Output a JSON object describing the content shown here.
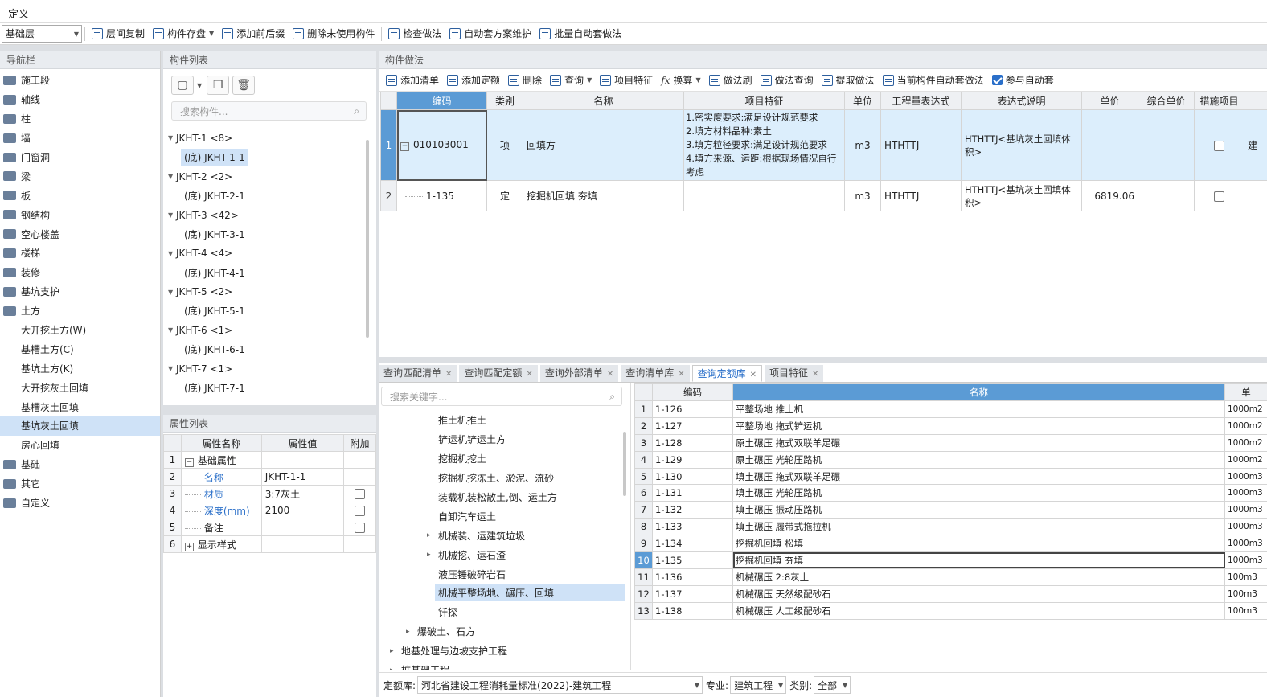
{
  "title": "定义",
  "toolbar": {
    "floor_select": "基础层",
    "buttons": [
      "层间复制",
      "构件存盘",
      "添加前后缀",
      "删除未使用构件",
      "检查做法",
      "自动套方案维护",
      "批量自动套做法"
    ]
  },
  "nav": {
    "header": "导航栏",
    "items": [
      {
        "label": "施工段",
        "sub": false
      },
      {
        "label": "轴线",
        "sub": false
      },
      {
        "label": "柱",
        "sub": false
      },
      {
        "label": "墙",
        "sub": false
      },
      {
        "label": "门窗洞",
        "sub": false
      },
      {
        "label": "梁",
        "sub": false
      },
      {
        "label": "板",
        "sub": false
      },
      {
        "label": "钢结构",
        "sub": false
      },
      {
        "label": "空心楼盖",
        "sub": false
      },
      {
        "label": "楼梯",
        "sub": false
      },
      {
        "label": "装修",
        "sub": false
      },
      {
        "label": "基坑支护",
        "sub": false
      },
      {
        "label": "土方",
        "sub": false
      },
      {
        "label": "大开挖土方(W)",
        "sub": true
      },
      {
        "label": "基槽土方(C)",
        "sub": true
      },
      {
        "label": "基坑土方(K)",
        "sub": true
      },
      {
        "label": "大开挖灰土回填",
        "sub": true
      },
      {
        "label": "基槽灰土回填",
        "sub": true
      },
      {
        "label": "基坑灰土回填",
        "sub": true,
        "selected": true
      },
      {
        "label": "房心回填",
        "sub": true
      },
      {
        "label": "基础",
        "sub": false
      },
      {
        "label": "其它",
        "sub": false
      },
      {
        "label": "自定义",
        "sub": false
      }
    ]
  },
  "components": {
    "header": "构件列表",
    "search_placeholder": "搜索构件...",
    "tree": [
      {
        "label": "JKHT-1 <8>",
        "group": true
      },
      {
        "label": "(底) JKHT-1-1",
        "group": false,
        "selected": true
      },
      {
        "label": "JKHT-2 <2>",
        "group": true
      },
      {
        "label": "(底) JKHT-2-1",
        "group": false
      },
      {
        "label": "JKHT-3 <42>",
        "group": true
      },
      {
        "label": "(底) JKHT-3-1",
        "group": false
      },
      {
        "label": "JKHT-4 <4>",
        "group": true
      },
      {
        "label": "(底) JKHT-4-1",
        "group": false
      },
      {
        "label": "JKHT-5 <2>",
        "group": true
      },
      {
        "label": "(底) JKHT-5-1",
        "group": false
      },
      {
        "label": "JKHT-6 <1>",
        "group": true
      },
      {
        "label": "(底) JKHT-6-1",
        "group": false
      },
      {
        "label": "JKHT-7 <1>",
        "group": true
      },
      {
        "label": "(底) JKHT-7-1",
        "group": false
      }
    ]
  },
  "properties": {
    "header": "属性列表",
    "columns": [
      "属性名称",
      "属性值",
      "附加"
    ],
    "rows": [
      {
        "n": "1",
        "name": "基础属性",
        "value": "",
        "expand": "−",
        "blue": false,
        "check": false
      },
      {
        "n": "2",
        "name": "名称",
        "value": "JKHT-1-1",
        "blue": true,
        "check": false
      },
      {
        "n": "3",
        "name": "材质",
        "value": "3:7灰土",
        "blue": true,
        "check": true
      },
      {
        "n": "4",
        "name": "深度(mm)",
        "value": "2100",
        "blue": true,
        "check": true
      },
      {
        "n": "5",
        "name": "备注",
        "value": "",
        "blue": false,
        "check": true
      },
      {
        "n": "6",
        "name": "显示样式",
        "value": "",
        "expand": "+",
        "blue": false,
        "check": false
      }
    ]
  },
  "method": {
    "header": "构件做法",
    "toolbar": [
      "添加清单",
      "添加定额",
      "删除",
      "查询",
      "项目特征",
      "换算",
      "做法刷",
      "做法查询",
      "提取做法",
      "当前构件自动套做法",
      "参与自动套"
    ],
    "columns": [
      "编码",
      "类别",
      "名称",
      "项目特征",
      "单位",
      "工程量表达式",
      "表达式说明",
      "单价",
      "综合单价",
      "措施项目"
    ],
    "rows": [
      {
        "n": "1",
        "code": "010103001",
        "type": "项",
        "name": "回填方",
        "features": [
          "1.密实度要求:满足设计规范要求",
          "2.填方材料品种:素土",
          "3.填方粒径要求:满足设计规范要求",
          "4.填方来源、运距:根据现场情况自行",
          "考虑"
        ],
        "unit": "m3",
        "expr": "HTHTTJ",
        "desc": "HTHTTJ<基坑灰土回填体积>",
        "price": "",
        "extra": "建"
      },
      {
        "n": "2",
        "code": "1-135",
        "type": "定",
        "name": "挖掘机回填 夯填",
        "features": [],
        "unit": "m3",
        "expr": "HTHTTJ",
        "desc": "HTHTTJ<基坑灰土回填体积>",
        "price": "6819.06",
        "extra": ""
      }
    ]
  },
  "query_tabs": [
    "查询匹配清单",
    "查询匹配定额",
    "查询外部清单",
    "查询清单库",
    "查询定额库",
    "项目特征"
  ],
  "query_tree": {
    "search_placeholder": "搜索关键字...",
    "items": [
      {
        "label": "推土机推土",
        "indent": 2
      },
      {
        "label": "铲运机铲运土方",
        "indent": 2
      },
      {
        "label": "挖掘机挖土",
        "indent": 2
      },
      {
        "label": "挖掘机挖冻土、淤泥、流砂",
        "indent": 2
      },
      {
        "label": "装载机装松散土,倒、运土方",
        "indent": 2
      },
      {
        "label": "自卸汽车运土",
        "indent": 2
      },
      {
        "label": "机械装、运建筑垃圾",
        "indent": 2,
        "arrow": "▸"
      },
      {
        "label": "机械挖、运石渣",
        "indent": 2,
        "arrow": "▸"
      },
      {
        "label": "液压锤破碎岩石",
        "indent": 2
      },
      {
        "label": "机械平整场地、碾压、回填",
        "indent": 2,
        "selected": true
      },
      {
        "label": "钎探",
        "indent": 2
      },
      {
        "label": "爆破土、石方",
        "indent": 1,
        "arrow": "▸"
      },
      {
        "label": "地基处理与边坡支护工程",
        "indent": 0,
        "arrow": "▸"
      },
      {
        "label": "桩基础工程",
        "indent": 0,
        "arrow": "▸"
      }
    ]
  },
  "quota": {
    "columns": [
      "编码",
      "名称",
      "单"
    ],
    "rows": [
      {
        "n": "1",
        "code": "1-126",
        "name": "平整场地 推土机",
        "unit": "1000m2"
      },
      {
        "n": "2",
        "code": "1-127",
        "name": "平整场地 拖式铲运机",
        "unit": "1000m2"
      },
      {
        "n": "3",
        "code": "1-128",
        "name": "原土碾压 拖式双联羊足碾",
        "unit": "1000m2"
      },
      {
        "n": "4",
        "code": "1-129",
        "name": "原土碾压 光轮压路机",
        "unit": "1000m2"
      },
      {
        "n": "5",
        "code": "1-130",
        "name": "填土碾压 拖式双联羊足碾",
        "unit": "1000m3"
      },
      {
        "n": "6",
        "code": "1-131",
        "name": "填土碾压 光轮压路机",
        "unit": "1000m3"
      },
      {
        "n": "7",
        "code": "1-132",
        "name": "填土碾压 振动压路机",
        "unit": "1000m3"
      },
      {
        "n": "8",
        "code": "1-133",
        "name": "填土碾压 履带式拖拉机",
        "unit": "1000m3"
      },
      {
        "n": "9",
        "code": "1-134",
        "name": "挖掘机回填 松填",
        "unit": "1000m3"
      },
      {
        "n": "10",
        "code": "1-135",
        "name": "挖掘机回填 夯填",
        "unit": "1000m3",
        "selected": true
      },
      {
        "n": "11",
        "code": "1-136",
        "name": "机械碾压 2:8灰土",
        "unit": "100m3"
      },
      {
        "n": "12",
        "code": "1-137",
        "name": "机械碾压 天然级配砂石",
        "unit": "100m3"
      },
      {
        "n": "13",
        "code": "1-138",
        "name": "机械碾压 人工级配砂石",
        "unit": "100m3"
      }
    ]
  },
  "bottom": {
    "db_label": "定额库:",
    "db_value": "河北省建设工程消耗量标准(2022)-建筑工程",
    "major_label": "专业:",
    "major_value": "建筑工程",
    "kind_label": "类别:",
    "kind_value": "全部"
  }
}
